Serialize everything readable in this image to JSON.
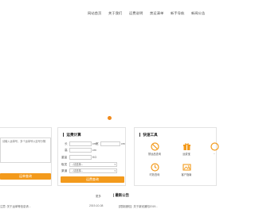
{
  "nav": {
    "items": [
      {
        "label": "网站首页"
      },
      {
        "label": "关于我们"
      },
      {
        "label": "运费说明"
      },
      {
        "label": "禁运清单"
      },
      {
        "label": "新手导航"
      },
      {
        "label": "新闻公告"
      }
    ]
  },
  "tracking": {
    "placeholder": "请输入运单号，多个运单号以逗号分隔",
    "button_label": "运单查询"
  },
  "calculator": {
    "title": "运费计算",
    "length_label": "长",
    "width_label": "宽",
    "height_label": "高",
    "unit": "cm",
    "weight_label": "重量",
    "weight_unit": "KG",
    "origin_label": "取发",
    "origin_value": "--请选择--",
    "channel_label": "渠道",
    "channel_value": "--请选择--",
    "button_label": "运费查询"
  },
  "tools": {
    "title": "快速工具",
    "items": [
      {
        "icon": "ban-icon",
        "label": "禁运品查询"
      },
      {
        "icon": "gift-icon",
        "label": "运费宝"
      },
      {
        "icon": "more-icon",
        "label": "..."
      },
      {
        "icon": "clock-icon",
        "label": "时效查询"
      },
      {
        "icon": "image-icon",
        "label": "客户指南"
      }
    ]
  },
  "footer": {
    "left_text": "注意: 关于运单等信息请...",
    "more_label": "更多",
    "news_title": "最新公告",
    "news_date": "2019-10-08",
    "news_tag": "【限制通知】",
    "news_text": "关于新冠通知2019..."
  },
  "colors": {
    "accent": "#f39a1c",
    "border": "#e3e3e3"
  }
}
